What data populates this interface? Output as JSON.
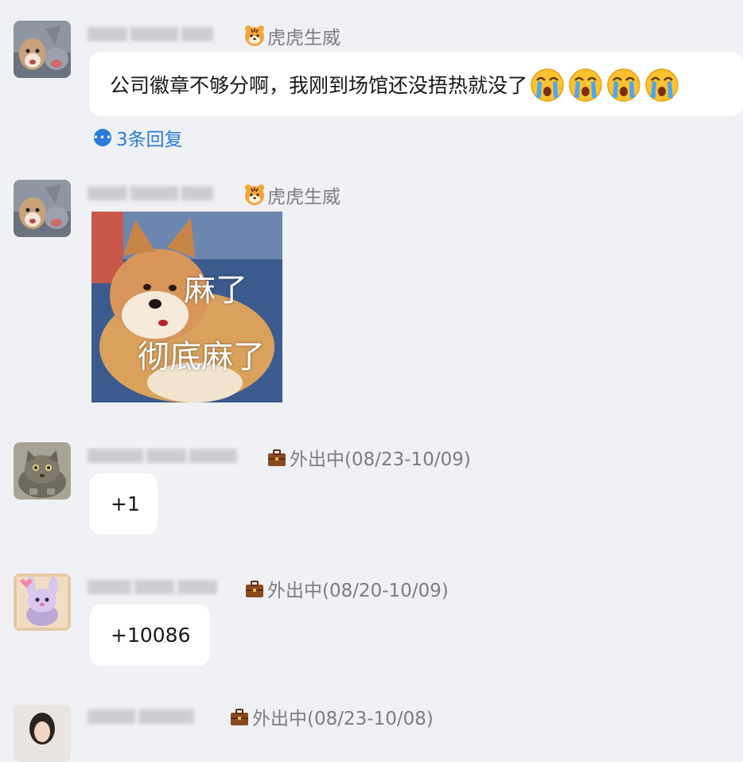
{
  "messages": [
    {
      "status_text": "虎虎生威",
      "status_icon": "tiger-icon",
      "text": "公司徽章不够分啊，我刚到场馆还没捂热就没了",
      "emojis": [
        "crying-face-emoji",
        "crying-face-emoji",
        "crying-face-emoji",
        "crying-face-emoji"
      ],
      "replies": "3条回复"
    },
    {
      "status_text": "虎虎生威",
      "status_icon": "tiger-icon",
      "sticker_caption_1": "麻了",
      "sticker_caption_2": "彻底麻了"
    },
    {
      "status_text": "外出中(08/23-10/09)",
      "status_icon": "briefcase-icon",
      "text": "+1"
    },
    {
      "status_text": "外出中(08/20-10/09)",
      "status_icon": "briefcase-icon",
      "text": "+10086"
    },
    {
      "status_text": "外出中(08/23-10/08)",
      "status_icon": "briefcase-icon"
    }
  ]
}
